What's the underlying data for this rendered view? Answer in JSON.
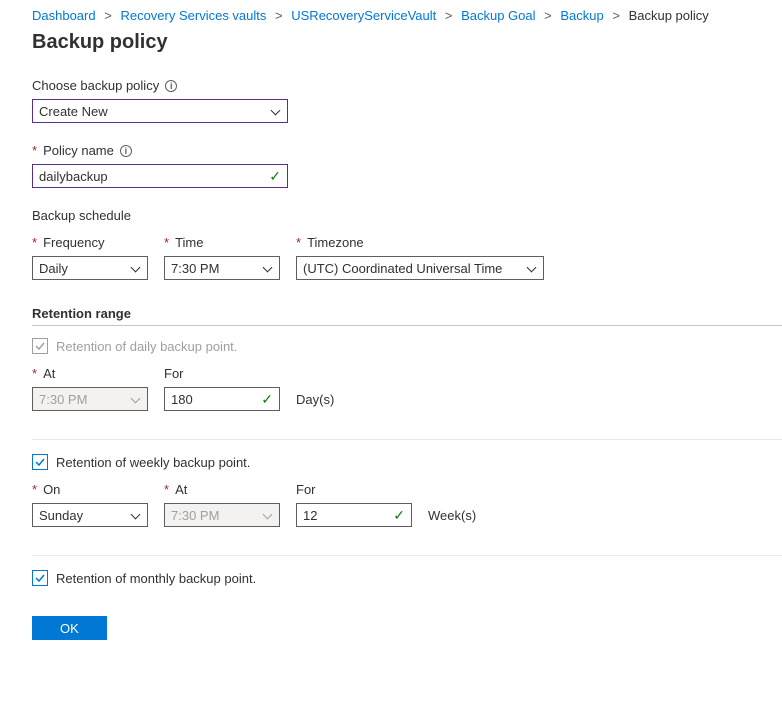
{
  "breadcrumb": {
    "items": [
      {
        "label": "Dashboard"
      },
      {
        "label": "Recovery Services vaults"
      },
      {
        "label": "USRecoveryServiceVault"
      },
      {
        "label": "Backup Goal"
      },
      {
        "label": "Backup"
      }
    ],
    "current": "Backup policy"
  },
  "title": "Backup policy",
  "choose_policy": {
    "label": "Choose backup policy",
    "value": "Create New"
  },
  "policy_name": {
    "label": "Policy name",
    "value": "dailybackup"
  },
  "schedule": {
    "heading": "Backup schedule",
    "frequency": {
      "label": "Frequency",
      "value": "Daily"
    },
    "time": {
      "label": "Time",
      "value": "7:30 PM"
    },
    "timezone": {
      "label": "Timezone",
      "value": "(UTC) Coordinated Universal Time"
    }
  },
  "retention": {
    "heading": "Retention range",
    "daily": {
      "label": "Retention of daily backup point.",
      "at_label": "At",
      "at_value": "7:30 PM",
      "for_label": "For",
      "for_value": "180",
      "unit": "Day(s)"
    },
    "weekly": {
      "label": "Retention of weekly backup point.",
      "on_label": "On",
      "on_value": "Sunday",
      "at_label": "At",
      "at_value": "7:30 PM",
      "for_label": "For",
      "for_value": "12",
      "unit": "Week(s)"
    },
    "monthly": {
      "label": "Retention of monthly backup point."
    }
  },
  "ok_button": "OK"
}
